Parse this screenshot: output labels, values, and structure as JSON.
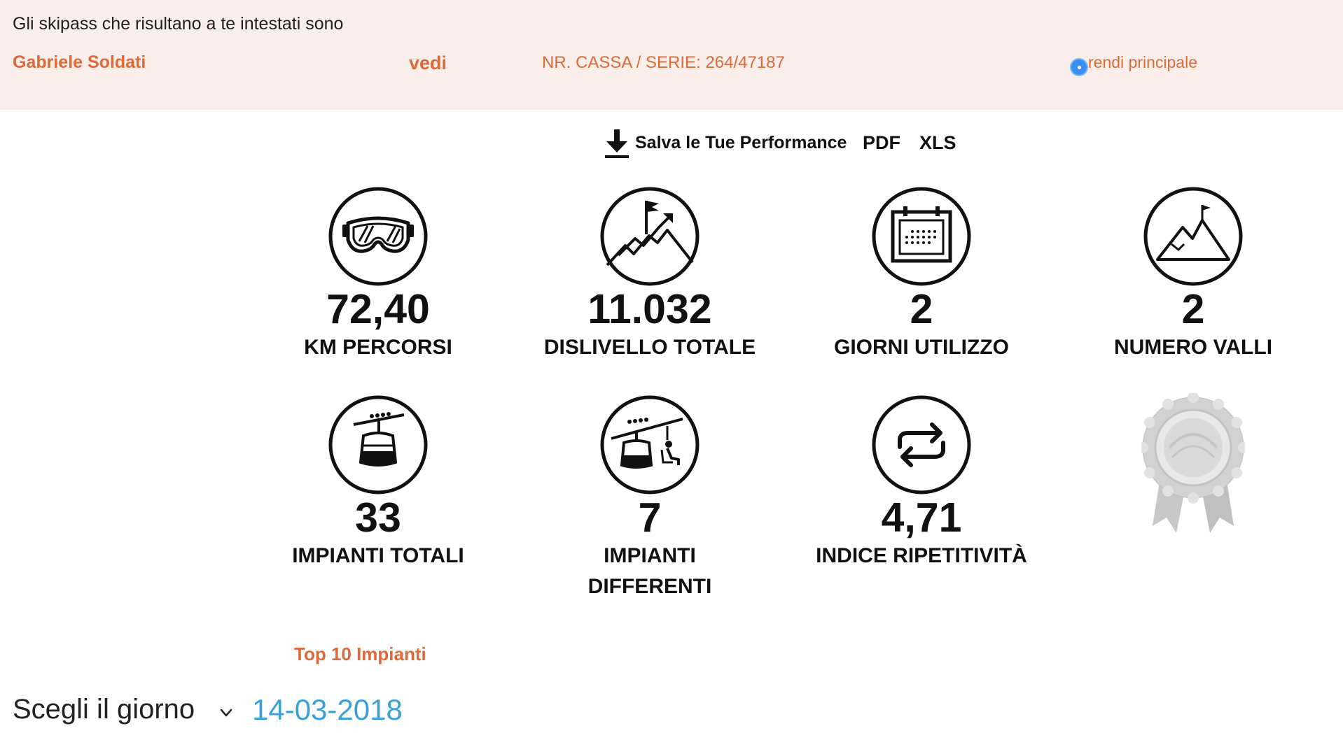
{
  "header": {
    "intro_text": "Gli skipass che risultano a te intestati sono",
    "owner_name": "Gabriele Soldati",
    "view_link": "vedi",
    "serial": "NR. CASSA / SERIE: 264/47187",
    "make_primary_label": "rendi principale"
  },
  "save_bar": {
    "label": "Salva le Tue Performance",
    "pdf": "PDF",
    "xls": "XLS"
  },
  "stats": {
    "km": {
      "value": "72,40",
      "label": "KM PERCORSI",
      "icon": "ski-goggles-icon"
    },
    "dislivello": {
      "value": "11.032",
      "label": "DISLIVELLO TOTALE",
      "icon": "mountain-climb-icon"
    },
    "giorni": {
      "value": "2",
      "label": "GIORNI UTILIZZO",
      "icon": "calendar-icon"
    },
    "valli": {
      "value": "2",
      "label": "NUMERO VALLI",
      "icon": "mountain-flag-icon"
    },
    "impianti_totali": {
      "value": "33",
      "label": "IMPIANTI TOTALI",
      "icon": "cable-car-icon"
    },
    "impianti_differenti": {
      "value": "7",
      "label_line1": "IMPIANTI",
      "label_line2": "DIFFERENTI",
      "icon": "cable-car-chairlift-icon"
    },
    "indice": {
      "value": "4,71",
      "label": "INDICE RIPETITIVITÀ",
      "icon": "repeat-icon"
    }
  },
  "award_icon": "award-rosette-icon",
  "top10_link": "Top 10 Impianti",
  "day_picker": {
    "label": "Scegli il giorno",
    "selected": "14-03-2018"
  },
  "colors": {
    "accent": "#dc6a3b",
    "band_bg": "#f9eee9",
    "date_blue": "#3b9fd8",
    "radio_blue": "#3b8ff0"
  }
}
